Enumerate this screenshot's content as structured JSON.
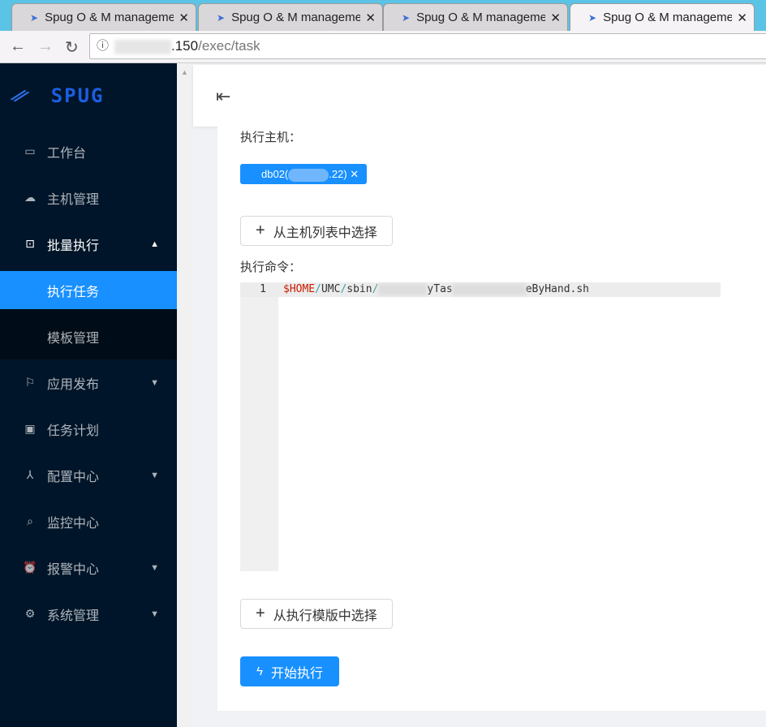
{
  "browser": {
    "tabs": [
      {
        "title": "Spug O & M management"
      },
      {
        "title": "Spug O & M management"
      },
      {
        "title": "Spug O & M management"
      },
      {
        "title": "Spug O & M management"
      }
    ],
    "url_visible": ".150",
    "url_path": "/exec/task"
  },
  "sidebar": {
    "logo": "SPUG",
    "items": [
      {
        "label": "工作台",
        "icon": "desktop-icon"
      },
      {
        "label": "主机管理",
        "icon": "cloud-server-icon"
      },
      {
        "label": "批量执行",
        "icon": "code-icon",
        "expanded": true,
        "children": [
          {
            "label": "执行任务",
            "selected": true
          },
          {
            "label": "模板管理"
          }
        ]
      },
      {
        "label": "应用发布",
        "icon": "flag-icon"
      },
      {
        "label": "任务计划",
        "icon": "schedule-icon"
      },
      {
        "label": "配置中心",
        "icon": "deployment-icon"
      },
      {
        "label": "监控中心",
        "icon": "monitor-icon"
      },
      {
        "label": "报警中心",
        "icon": "alarm-icon"
      },
      {
        "label": "系统管理",
        "icon": "setting-icon"
      }
    ]
  },
  "form": {
    "hosts_label": "执行主机：",
    "host_tag": "db02(",
    "host_tag_end": ".22)",
    "select_hosts_btn": "从主机列表中选择",
    "command_label": "执行命令：",
    "editor": {
      "line_no": "1",
      "var": "$HOME",
      "p1": "/",
      "p2": "UMC",
      "p3": "/",
      "p4": "sbin",
      "p5": "/",
      "p6": "yTas",
      "p7": "eByHand.sh"
    },
    "select_template_btn": "从执行模版中选择",
    "run_btn": "开始执行"
  },
  "colors": {
    "primary": "#1890ff",
    "sidebar": "#001529"
  }
}
